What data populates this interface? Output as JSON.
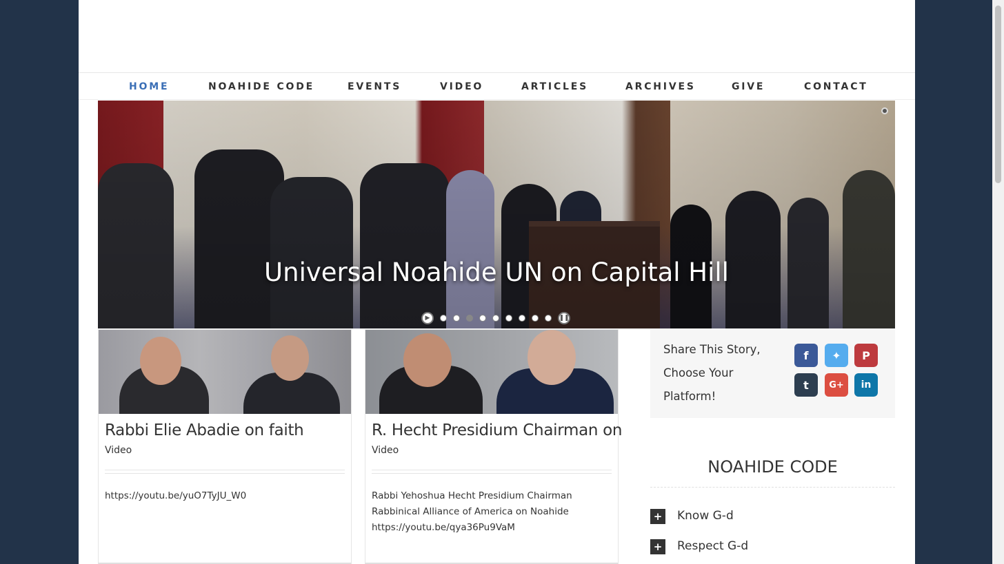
{
  "nav": {
    "items": [
      {
        "label": "HOME",
        "active": true
      },
      {
        "label": "NOAHIDE CODE",
        "active": false
      },
      {
        "label": "EVENTS",
        "active": false
      },
      {
        "label": "VIDEO",
        "active": false
      },
      {
        "label": "ARTICLES",
        "active": false
      },
      {
        "label": "ARCHIVES",
        "active": false
      },
      {
        "label": "GIVE",
        "active": false
      },
      {
        "label": "CONTACT",
        "active": false
      }
    ],
    "active_color": "#3b6fb6"
  },
  "slider": {
    "caption": "Universal Noahide UN on Capital Hill",
    "slide_count": 9,
    "current_slide": 3,
    "prev_icon": "play-icon",
    "pause_icon": "pause-icon"
  },
  "posts": [
    {
      "title": "Rabbi Elie Abadie on faith",
      "category": "Video",
      "body": "https://youtu.be/yuO7TyJU_W0"
    },
    {
      "title": "R. Hecht Presidium Chairman on",
      "category": "Video",
      "body": "Rabbi Yehoshua Hecht Presidium Chairman Rabbinical Alliance of America on Noahide https://youtu.be/qya36Pu9VaM"
    }
  ],
  "share": {
    "text": "Share This Story, Choose Your Platform!",
    "networks": [
      {
        "name": "facebook",
        "glyph": "f",
        "color": "#3b5998"
      },
      {
        "name": "twitter",
        "glyph": "t",
        "color": "#55acee"
      },
      {
        "name": "pinterest",
        "glyph": "P",
        "color": "#bd3a3e"
      },
      {
        "name": "tumblr",
        "glyph": "t",
        "color": "#2d3e50"
      },
      {
        "name": "google-plus",
        "glyph": "G+",
        "color": "#dc4e41"
      },
      {
        "name": "linkedin",
        "glyph": "in",
        "color": "#0e76a8"
      }
    ]
  },
  "sidebar": {
    "widget_title": "NOAHIDE CODE",
    "accordion": [
      {
        "label": "Know G-d"
      },
      {
        "label": "Respect G-d"
      }
    ]
  },
  "colors": {
    "background": "#223349",
    "page": "#ffffff"
  }
}
